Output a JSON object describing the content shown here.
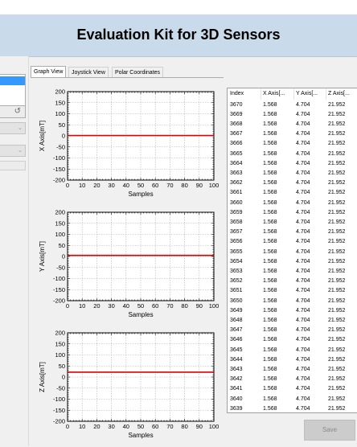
{
  "app": {
    "title": "Evaluation Kit for 3D Sensors"
  },
  "left_panel": {
    "refresh_glyph": "↺",
    "combo_glyph": "⌄"
  },
  "tabs": [
    "Graph View",
    "Joystick View",
    "Polar Coordinates"
  ],
  "charts": [
    {
      "ylabel": "X Axis[mT]",
      "xlabel": "Samples",
      "ylim": [
        -200,
        200
      ],
      "yticks": [
        "200",
        "150",
        "100",
        "50",
        "0",
        "-50",
        "-100",
        "-150",
        "-200"
      ],
      "xticks": [
        "0",
        "10",
        "20",
        "30",
        "40",
        "50",
        "60",
        "70",
        "80",
        "90",
        "100"
      ],
      "value": 1.568,
      "color": "#e00000"
    },
    {
      "ylabel": "Y Axis[mT]",
      "xlabel": "Samples",
      "ylim": [
        -200,
        200
      ],
      "yticks": [
        "200",
        "150",
        "100",
        "50",
        "0",
        "-50",
        "-100",
        "-150",
        "-200"
      ],
      "xticks": [
        "0",
        "10",
        "20",
        "30",
        "40",
        "50",
        "60",
        "70",
        "80",
        "90",
        "100"
      ],
      "value": 4.704,
      "color": "#e00000"
    },
    {
      "ylabel": "Z Axis[mT]",
      "xlabel": "Samples",
      "ylim": [
        -200,
        200
      ],
      "yticks": [
        "200",
        "150",
        "100",
        "50",
        "0",
        "-50",
        "-100",
        "-150",
        "-200"
      ],
      "xticks": [
        "0",
        "10",
        "20",
        "30",
        "40",
        "50",
        "60",
        "70",
        "80",
        "90",
        "100"
      ],
      "value": 21.952,
      "color": "#e00000"
    }
  ],
  "chart_data": [
    {
      "type": "line",
      "ylabel": "X Axis[mT]",
      "xlabel": "Samples",
      "xlim": [
        0,
        100
      ],
      "ylim": [
        -200,
        200
      ],
      "grid": true,
      "series": [
        {
          "values": [
            1.568,
            1.568
          ]
        }
      ]
    },
    {
      "type": "line",
      "ylabel": "Y Axis[mT]",
      "xlabel": "Samples",
      "xlim": [
        0,
        100
      ],
      "ylim": [
        -200,
        200
      ],
      "grid": true,
      "series": [
        {
          "values": [
            4.704,
            4.704
          ]
        }
      ]
    },
    {
      "type": "line",
      "ylabel": "Z Axis[mT]",
      "xlabel": "Samples",
      "xlim": [
        0,
        100
      ],
      "ylim": [
        -200,
        200
      ],
      "grid": true,
      "series": [
        {
          "values": [
            21.952,
            21.952
          ]
        }
      ]
    }
  ],
  "table": {
    "headers": [
      "Index",
      "X Axis[...",
      "Y Axis[...",
      "Z Axis[..."
    ],
    "rows": [
      [
        "3670",
        "1.568",
        "4.704",
        "21.952"
      ],
      [
        "3669",
        "1.568",
        "4.704",
        "21.952"
      ],
      [
        "3668",
        "1.568",
        "4.704",
        "21.952"
      ],
      [
        "3667",
        "1.568",
        "4.704",
        "21.952"
      ],
      [
        "3666",
        "1.568",
        "4.704",
        "21.952"
      ],
      [
        "3665",
        "1.568",
        "4.704",
        "21.952"
      ],
      [
        "3664",
        "1.568",
        "4.704",
        "21.952"
      ],
      [
        "3663",
        "1.568",
        "4.704",
        "21.952"
      ],
      [
        "3662",
        "1.568",
        "4.704",
        "21.952"
      ],
      [
        "3661",
        "1.568",
        "4.704",
        "21.952"
      ],
      [
        "3660",
        "1.568",
        "4.704",
        "21.952"
      ],
      [
        "3659",
        "1.568",
        "4.704",
        "21.952"
      ],
      [
        "3658",
        "1.568",
        "4.704",
        "21.952"
      ],
      [
        "3657",
        "1.568",
        "4.704",
        "21.952"
      ],
      [
        "3656",
        "1.568",
        "4.704",
        "21.952"
      ],
      [
        "3655",
        "1.568",
        "4.704",
        "21.952"
      ],
      [
        "3654",
        "1.568",
        "4.704",
        "21.952"
      ],
      [
        "3653",
        "1.568",
        "4.704",
        "21.952"
      ],
      [
        "3652",
        "1.568",
        "4.704",
        "21.952"
      ],
      [
        "3651",
        "1.568",
        "4.704",
        "21.952"
      ],
      [
        "3650",
        "1.568",
        "4.704",
        "21.952"
      ],
      [
        "3649",
        "1.568",
        "4.704",
        "21.952"
      ],
      [
        "3648",
        "1.568",
        "4.704",
        "21.952"
      ],
      [
        "3647",
        "1.568",
        "4.704",
        "21.952"
      ],
      [
        "3646",
        "1.568",
        "4.704",
        "21.952"
      ],
      [
        "3645",
        "1.568",
        "4.704",
        "21.952"
      ],
      [
        "3644",
        "1.568",
        "4.704",
        "21.952"
      ],
      [
        "3643",
        "1.568",
        "4.704",
        "21.952"
      ],
      [
        "3642",
        "1.568",
        "4.704",
        "21.952"
      ],
      [
        "3641",
        "1.568",
        "4.704",
        "21.952"
      ],
      [
        "3640",
        "1.568",
        "4.704",
        "21.952"
      ],
      [
        "3639",
        "1.568",
        "4.704",
        "21.952"
      ]
    ]
  },
  "save_label": "Save"
}
